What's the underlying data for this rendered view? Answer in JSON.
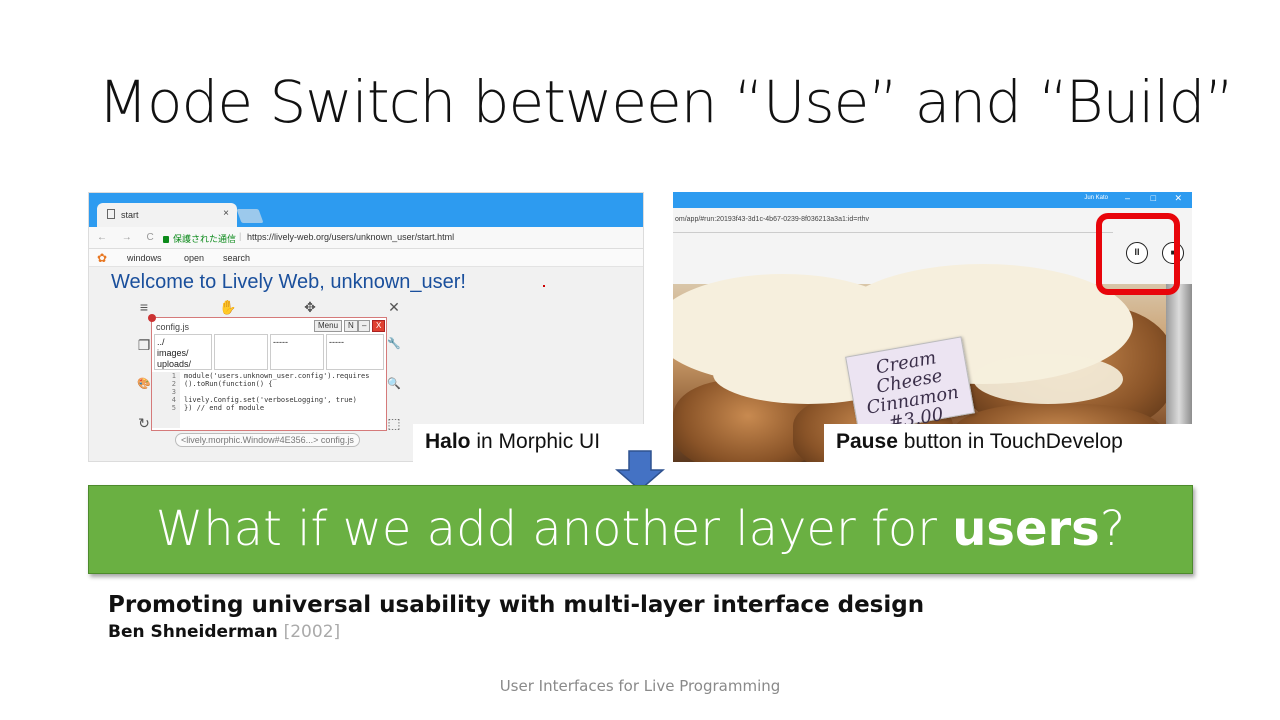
{
  "slide": {
    "title": "Mode Switch between “Use” and “Build”",
    "footer": "User Interfaces for Live Programming"
  },
  "left_shot": {
    "tab_title": "start",
    "tab_close": "×",
    "nav_buttons": "← → C",
    "secure_label": "保護された通信",
    "url": "https://lively-web.org/users/unknown_user/start.html",
    "menu": [
      "windows",
      "open",
      "search"
    ],
    "welcome": "Welcome to Lively Web, unknown_user!",
    "halo_icons": {
      "menu": "≡",
      "grab": "✋",
      "move": "✥",
      "close": "✕",
      "copy": "❐",
      "tools": "🔧",
      "style": "🎨",
      "inspect": "🔍",
      "rotate": "↻",
      "resize": "⬚"
    },
    "code_window": {
      "title": "config.js",
      "menu_button": "Menu",
      "n_button": "N",
      "min_button": "–",
      "close_button": "X",
      "list1": [
        "../",
        "images/",
        "uploads/"
      ],
      "list2": "-----",
      "list3": "-----",
      "gutter": [
        "1",
        "2",
        "3",
        "4",
        "5"
      ],
      "code": [
        "module('users.unknown_user.config').requires",
        "  ().toRun(function() {",
        "",
        "lively.Config.set('verboseLogging', true)",
        "}) // end of module"
      ],
      "label": "<lively.morphic.Window#4E356...> config.js"
    },
    "caption_bold": "Halo",
    "caption_rest": " in Morphic UI"
  },
  "right_shot": {
    "window_user": "Jun Kato",
    "window_controls": [
      "–",
      "□",
      "✕"
    ],
    "url": "om/app/#run:20193f43-3d1c-4b67-0239-8f036213a3a1:id=rthv",
    "pause_symbol": "II",
    "stop_symbol": "■",
    "sign_text": [
      "Cream Cheese",
      "Cinnamon",
      "#3.00"
    ],
    "caption_bold": "Pause",
    "caption_rest": " button in TouchDevelop"
  },
  "banner": {
    "before": "What if we add another layer for ",
    "bold": "users",
    "after": "?"
  },
  "reference": {
    "title": "Promoting universal usability with multi-layer interface design",
    "author": "Ben Shneiderman",
    "year": "[2002]"
  },
  "colors": {
    "banner_green": "#6ab042",
    "arrow_blue": "#4472c4",
    "highlight_red": "#e8050b",
    "chrome_blue": "#2d9bf0"
  }
}
